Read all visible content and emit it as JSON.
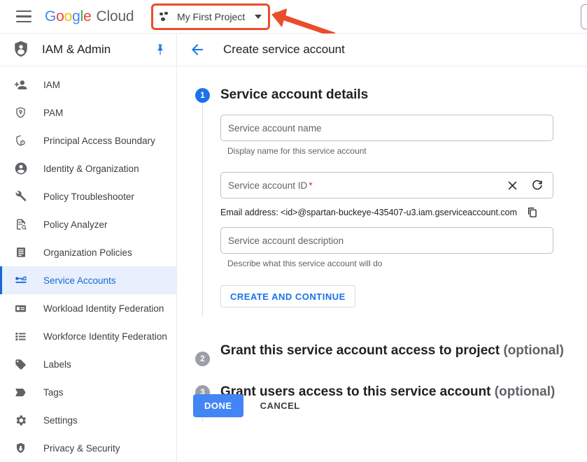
{
  "topbar": {
    "menu_icon": "hamburger-menu-icon",
    "brand_google": [
      "G",
      "o",
      "o",
      "g",
      "l",
      "e"
    ],
    "brand_cloud": "Cloud",
    "project": {
      "icon": "project-dots-icon",
      "name": "My First Project",
      "caret": "chevron-down-icon"
    },
    "annotation": {
      "type": "arrow-pointing-left",
      "color": "#ea4d2c"
    }
  },
  "sidebar": {
    "header": {
      "icon": "iam-shield-person-icon",
      "title": "IAM & Admin",
      "pin_icon": "pin-icon"
    },
    "items": [
      {
        "label": "IAM",
        "icon": "person-add-icon",
        "active": false
      },
      {
        "label": "PAM",
        "icon": "shield-key-icon",
        "active": false
      },
      {
        "label": "Principal Access Boundary",
        "icon": "shield-boundary-icon",
        "active": false
      },
      {
        "label": "Identity & Organization",
        "icon": "account-circle-icon",
        "active": false
      },
      {
        "label": "Policy Troubleshooter",
        "icon": "wrench-icon",
        "active": false
      },
      {
        "label": "Policy Analyzer",
        "icon": "document-search-icon",
        "active": false
      },
      {
        "label": "Organization Policies",
        "icon": "list-document-icon",
        "active": false
      },
      {
        "label": "Service Accounts",
        "icon": "service-account-key-icon",
        "active": true
      },
      {
        "label": "Workload Identity Federation",
        "icon": "id-card-icon",
        "active": false
      },
      {
        "label": "Workforce Identity Federation",
        "icon": "bullet-list-icon",
        "active": false
      },
      {
        "label": "Labels",
        "icon": "label-tag-icon",
        "active": false
      },
      {
        "label": "Tags",
        "icon": "tag-arrow-icon",
        "active": false
      },
      {
        "label": "Settings",
        "icon": "gear-icon",
        "active": false
      },
      {
        "label": "Privacy & Security",
        "icon": "shield-icon",
        "active": false
      }
    ]
  },
  "main": {
    "back_icon": "back-arrow-icon",
    "page_title": "Create service account",
    "steps": [
      {
        "number": "1",
        "title": "Service account details",
        "optional_suffix": "",
        "state": "active"
      },
      {
        "number": "2",
        "title": "Grant this service account access to project",
        "optional_suffix": "(optional)",
        "state": "inactive"
      },
      {
        "number": "3",
        "title": "Grant users access to this service account",
        "optional_suffix": "(optional)",
        "state": "inactive"
      }
    ],
    "form": {
      "name_field": {
        "placeholder": "Service account name",
        "value": "",
        "helper": "Display name for this service account"
      },
      "id_field": {
        "placeholder": "Service account ID",
        "required_marker": "*",
        "value": "",
        "clear_icon": "close-icon",
        "refresh_icon": "refresh-icon"
      },
      "email_line": {
        "text": "Email address: <id>@spartan-buckeye-435407-u3.iam.gserviceaccount.com",
        "copy_icon": "copy-icon"
      },
      "description_field": {
        "placeholder": "Service account description",
        "value": "",
        "helper": "Describe what this service account will do"
      },
      "create_continue_button": "CREATE AND CONTINUE"
    },
    "footer": {
      "done_button": "DONE",
      "cancel_button": "CANCEL"
    }
  },
  "colors": {
    "accent_blue": "#1a73e8",
    "done_blue": "#4285f4",
    "active_nav_bg": "#e8f0fe",
    "active_nav_text": "#1967d2",
    "annotation_red": "#ea4d2c",
    "required_red": "#d93025",
    "grey_step": "#9aa0a6"
  }
}
